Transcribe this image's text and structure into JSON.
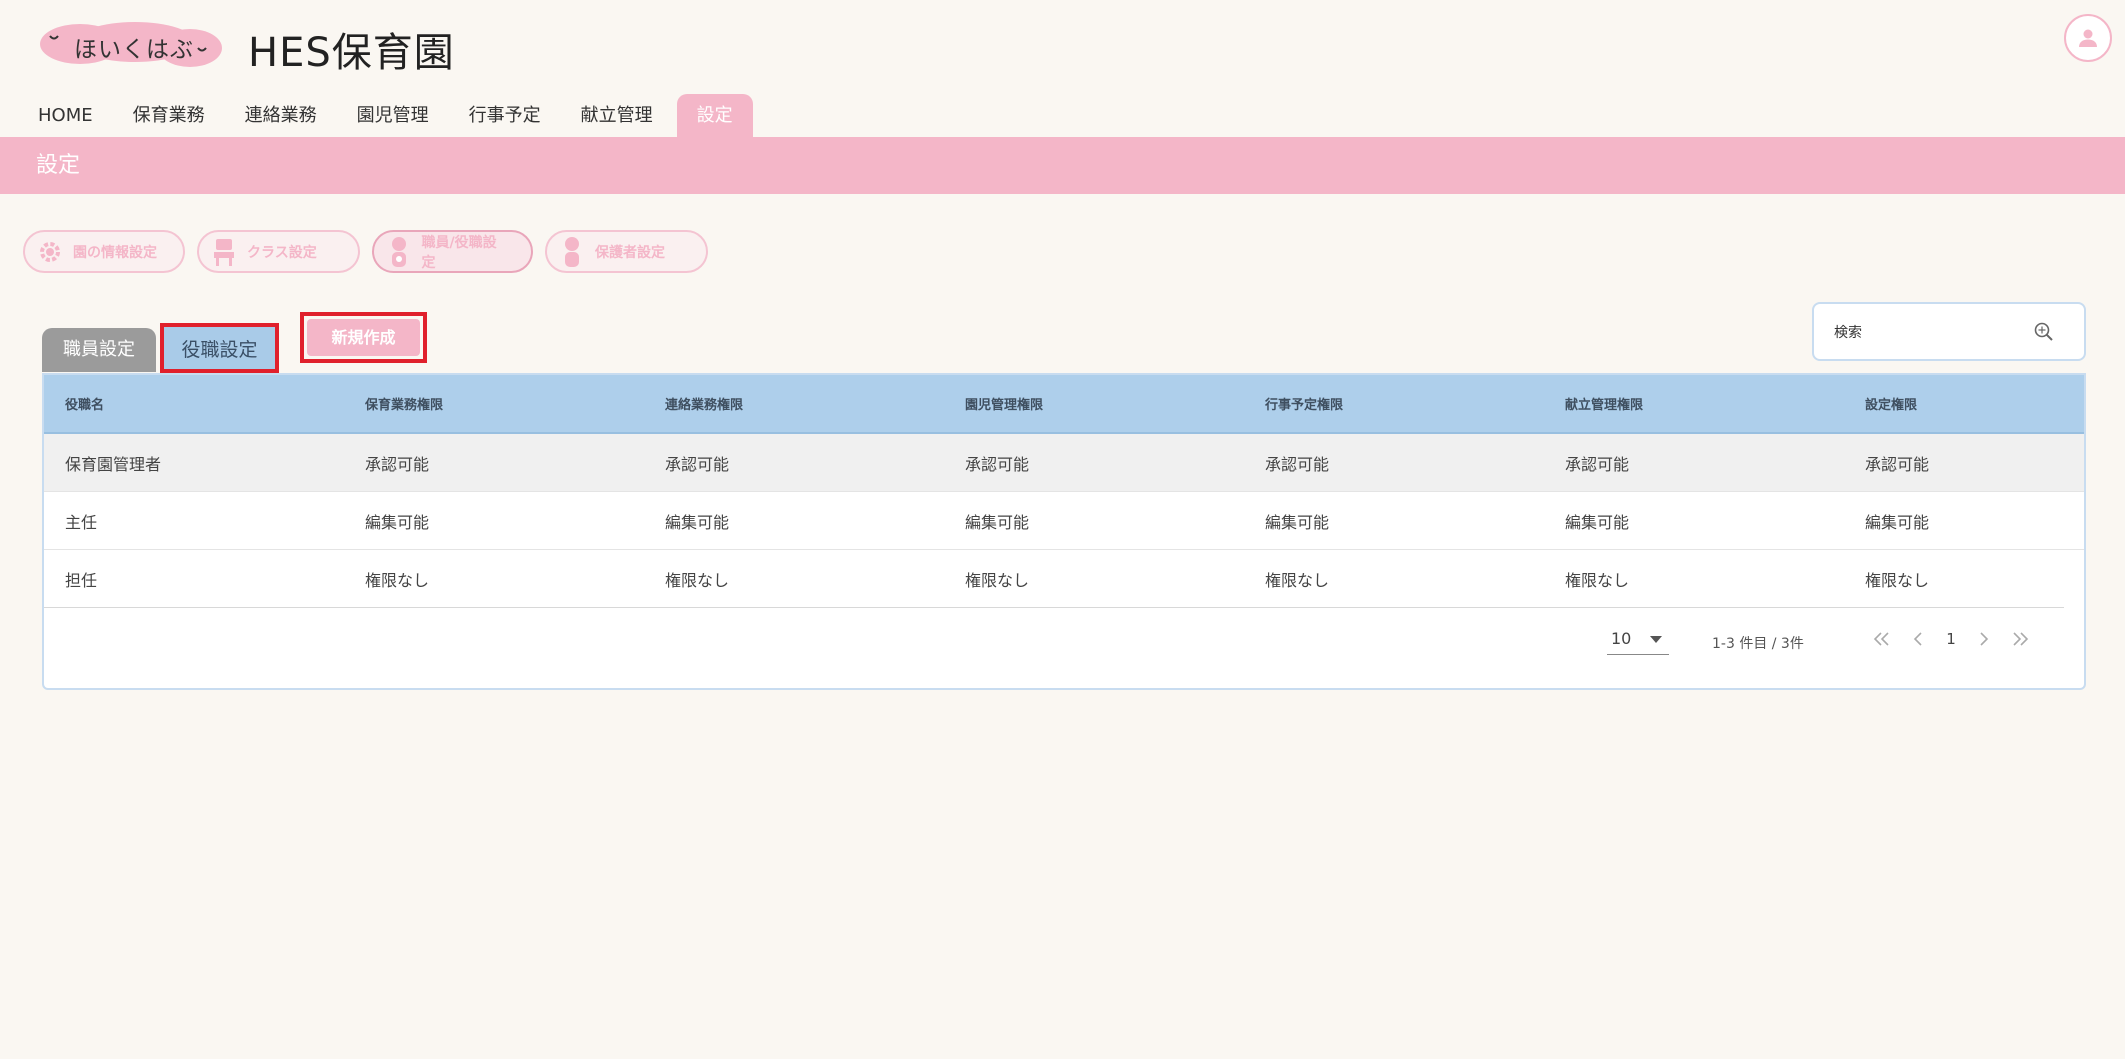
{
  "header": {
    "logo_text": "ほいくはぶ",
    "brand_title": "HES保育園"
  },
  "nav": {
    "items": [
      {
        "label": "HOME"
      },
      {
        "label": "保育業務"
      },
      {
        "label": "連絡業務"
      },
      {
        "label": "園児管理"
      },
      {
        "label": "行事予定"
      },
      {
        "label": "献立管理"
      },
      {
        "label": "設定"
      }
    ]
  },
  "banner": {
    "title": "設定"
  },
  "settings": {
    "buttons": [
      {
        "label": "園の情報設定",
        "icon": "gear-icon"
      },
      {
        "label": "クラス設定",
        "icon": "class-icon"
      },
      {
        "label": "職員/役職設定",
        "icon": "staff-icon"
      },
      {
        "label": "保護者設定",
        "icon": "parent-icon"
      }
    ]
  },
  "tabs": {
    "staff": "職員設定",
    "role": "役職設定"
  },
  "toolbar": {
    "new_label": "新規作成",
    "search_placeholder": "検索"
  },
  "table": {
    "columns": [
      "役職名",
      "保育業務権限",
      "連絡業務権限",
      "園児管理権限",
      "行事予定権限",
      "献立管理権限",
      "設定権限"
    ],
    "rows": [
      [
        "保育園管理者",
        "承認可能",
        "承認可能",
        "承認可能",
        "承認可能",
        "承認可能",
        "承認可能"
      ],
      [
        "主任",
        "編集可能",
        "編集可能",
        "編集可能",
        "編集可能",
        "編集可能",
        "編集可能"
      ],
      [
        "担任",
        "権限なし",
        "権限なし",
        "権限なし",
        "権限なし",
        "権限なし",
        "権限なし"
      ]
    ]
  },
  "pagination": {
    "per_page": "10",
    "range_text": "1-3 件目 / 3件",
    "current_page": "1"
  },
  "colors": {
    "accent_pink": "#f4b6c8",
    "header_blue": "#aecfeb",
    "highlight_red": "#e0202c"
  }
}
